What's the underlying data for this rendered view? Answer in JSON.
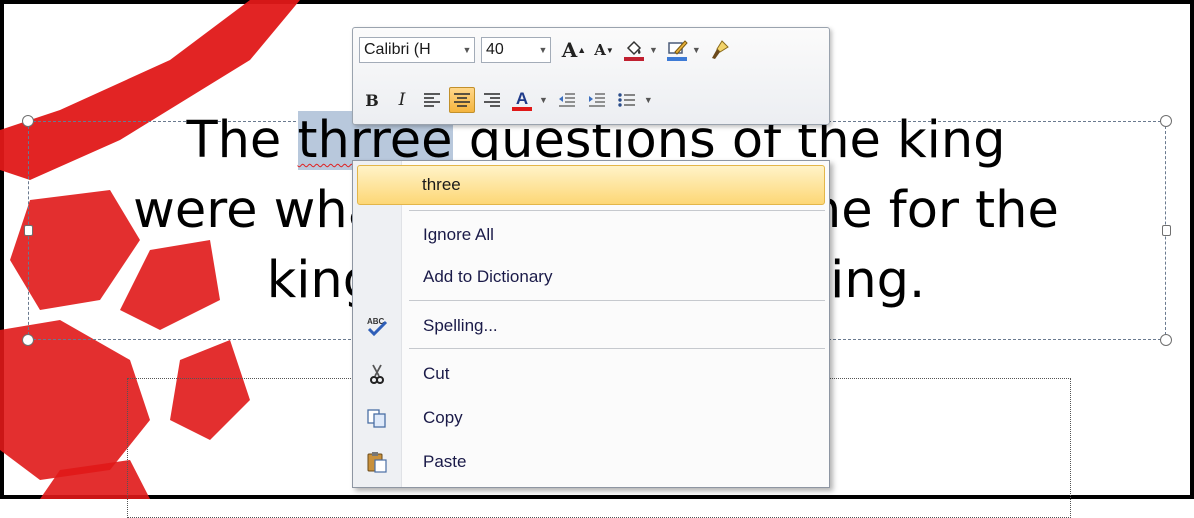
{
  "slide": {
    "line1_before": "The ",
    "line1_misspelled": "thrree",
    "line1_after": " questions of the king",
    "line2": "were what was the best time for the",
    "line3": "king to begin every thing."
  },
  "mini_toolbar": {
    "font_name": "Calibri (H",
    "font_size": "40",
    "grow_font": "A",
    "shrink_font": "A",
    "bold": "B",
    "italic": "I",
    "font_color_glyph": "A"
  },
  "context_menu": {
    "suggestion": "three",
    "ignore_all": "Ignore All",
    "add_to_dictionary": "Add to Dictionary",
    "spelling": "Spelling...",
    "cut": "Cut",
    "copy": "Copy",
    "paste": "Paste"
  },
  "colors": {
    "highlight": "#fdd776",
    "watermark": "#e01818",
    "font_color_bar": "#e01818"
  },
  "icons": [
    "fill-color-icon",
    "highlight-icon",
    "format-painter-icon",
    "align-left-icon",
    "align-center-icon",
    "align-right-icon",
    "decrease-indent-icon",
    "increase-indent-icon",
    "bullets-icon",
    "spelling-icon",
    "cut-icon",
    "copy-icon",
    "paste-icon"
  ]
}
